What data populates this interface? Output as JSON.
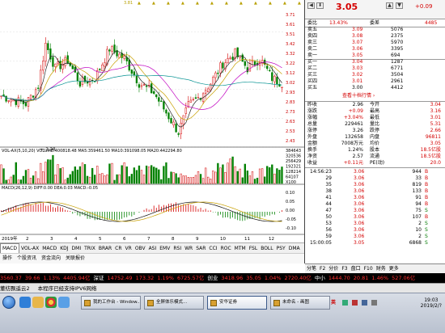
{
  "top_markers": [
    "3.81",
    "▲",
    "▲",
    "▲",
    "▲",
    "▲",
    "▲",
    "▲",
    "▲",
    "▲",
    "▲",
    "▲",
    "▲"
  ],
  "kline": {
    "title": "",
    "y_labels": [
      "3.81",
      "3.71",
      "3.61",
      "3.51",
      "3.42",
      "3.32",
      "3.22",
      "3.12",
      "3.02",
      "2.93",
      "2.83",
      "2.73",
      "2.63",
      "2.53",
      "2.43"
    ],
    "high_label": "3.81",
    "low_label": "2.38"
  },
  "volume": {
    "legend": "VOL-AX(5,10,20) VOLUME:400818.48 MA5:359461.50 MA10:391098.05 MA20:442294.80",
    "y_labels": [
      "384643",
      "320536",
      "256429",
      "192321",
      "128214",
      "64107",
      "X100"
    ]
  },
  "macd": {
    "legend": "MACD(26,12,9) DIFF:0.00 DEA:0.03 MACD:-0.05",
    "y_labels": [
      "0.10",
      "0.05",
      "0.00",
      "-0.05",
      "-0.10"
    ]
  },
  "x_axis": {
    "labels": [
      "2019年",
      "2",
      "3",
      "4",
      "5",
      "6",
      "7",
      "8",
      "9",
      "10",
      "11",
      "12"
    ]
  },
  "indicator_tabs": [
    "MACD",
    "VOL-AX",
    "MACD",
    "KDJ",
    "DMI",
    "TRIX",
    "BRAR",
    "CR",
    "VR",
    "OBV",
    "ASI",
    "EMV",
    "RSI",
    "WR",
    "SAR",
    "CCI",
    "ROC",
    "MTM",
    "FSL",
    "BOLL",
    "PSY",
    "DMA"
  ],
  "sub_tabs": [
    "操作",
    "个股资讯",
    "资金流向",
    "关联报价"
  ],
  "quote": {
    "price": "3.05",
    "change": "+0.09",
    "header_icons": [
      "◀",
      "⬇",
      "▲",
      "▼"
    ],
    "wb": {
      "label": "委比",
      "val": "13.43%",
      "label2": "委差",
      "val2": "4485"
    },
    "sells": [
      {
        "label": "卖五",
        "price": "3.09",
        "vol": "5076"
      },
      {
        "label": "卖四",
        "price": "3.08",
        "vol": "2375"
      },
      {
        "label": "卖三",
        "price": "3.07",
        "vol": "5970"
      },
      {
        "label": "卖二",
        "price": "3.06",
        "vol": "3395"
      },
      {
        "label": "卖一",
        "price": "3.05",
        "vol": "694"
      }
    ],
    "buys": [
      {
        "label": "买一",
        "price": "3.04",
        "vol": "1287"
      },
      {
        "label": "买二",
        "price": "3.03",
        "vol": "6771"
      },
      {
        "label": "买三",
        "price": "3.02",
        "vol": "3504"
      },
      {
        "label": "买四",
        "price": "3.01",
        "vol": "2961"
      },
      {
        "label": "买五",
        "price": "3.00",
        "vol": "4412"
      }
    ],
    "link": "查看十档行情 ›",
    "stats": [
      {
        "l1": "昨收",
        "v1": "2.96",
        "l2": "今开",
        "v2": "3.04"
      },
      {
        "l1": "涨跌",
        "v1": "+0.09",
        "l2": "最高",
        "v2": "3.16"
      },
      {
        "l1": "涨幅",
        "v1": "+3.04%",
        "l2": "最低",
        "v2": "3.01"
      },
      {
        "l1": "总量",
        "v1": "229461",
        "l2": "量比",
        "v2": "5.31"
      },
      {
        "l1": "涨停",
        "v1": "3.26",
        "l2": "跌停",
        "v2": "2.66"
      },
      {
        "l1": "外盘",
        "v1": "132658",
        "l2": "内盘",
        "v2": "96811"
      },
      {
        "l1": "金额",
        "v1": "7008万元",
        "l2": "均价",
        "v2": "3.05"
      },
      {
        "l1": "换手",
        "v1": "1.24%",
        "l2": "股本",
        "v2": "18.5亿股"
      },
      {
        "l1": "净资",
        "v1": "2.57",
        "l2": "流通",
        "v2": "18.5亿股"
      },
      {
        "l1": "收益",
        "v1": "+0.11元",
        "l2": "PE(动)",
        "v2": "20.0"
      }
    ],
    "trades": [
      {
        "t": "14:56:23",
        "p": "3.06",
        "v": "944",
        "d": "B"
      },
      {
        "t": "29",
        "p": "3.06",
        "v": "33",
        "d": "B"
      },
      {
        "t": "35",
        "p": "3.06",
        "v": "819",
        "d": "B"
      },
      {
        "t": "38",
        "p": "3.06",
        "v": "133",
        "d": "B"
      },
      {
        "t": "41",
        "p": "3.06",
        "v": "91",
        "d": "B"
      },
      {
        "t": "44",
        "p": "3.06",
        "v": "94",
        "d": "B"
      },
      {
        "t": "47",
        "p": "3.06",
        "v": "75",
        "d": "S"
      },
      {
        "t": "50",
        "p": "3.06",
        "v": "107",
        "d": "B"
      },
      {
        "t": "53",
        "p": "3.06",
        "v": "2",
        "d": "S"
      },
      {
        "t": "56",
        "p": "3.06",
        "v": "10",
        "d": "S"
      },
      {
        "t": "59",
        "p": "3.06",
        "v": "2",
        "d": "S"
      },
      {
        "t": "15:00:05",
        "p": "3.05",
        "v": "6868",
        "d": "S"
      }
    ],
    "tabs": [
      "分笔",
      "F2",
      "分价",
      "F3",
      "盘口",
      "F10",
      "财务",
      "更多"
    ]
  },
  "ticker": [
    {
      "t": "3560.37",
      "c": "red"
    },
    {
      "t": "39.66",
      "c": "red"
    },
    {
      "t": "1.13%",
      "c": "red"
    },
    {
      "t": "4405.94亿",
      "c": "red"
    },
    {
      "t": "深证",
      "c": "white"
    },
    {
      "t": "14752.49",
      "c": "red"
    },
    {
      "t": "173.32",
      "c": "red"
    },
    {
      "t": "1.19%",
      "c": "red"
    },
    {
      "t": "6725.57亿",
      "c": "red"
    },
    {
      "t": "创业",
      "c": "white"
    },
    {
      "t": "3418.96",
      "c": "red"
    },
    {
      "t": "35.05",
      "c": "red"
    },
    {
      "t": "1.04%",
      "c": "red"
    },
    {
      "t": "2720.40亿",
      "c": "red"
    },
    {
      "t": "中小",
      "c": "white"
    },
    {
      "t": "1444.70",
      "c": "red"
    },
    {
      "t": "20.81",
      "c": "red"
    },
    {
      "t": "1.46%",
      "c": "red"
    },
    {
      "t": "527.06亿",
      "c": "red"
    }
  ],
  "notice": [
    "董纺飘遥云2",
    "本程序已经支持IPV6网络"
  ],
  "taskbar": {
    "windows": [
      "我的工作台 - Window...",
      "全屏体乐模式...",
      "安华证券",
      "未命名 - 画图"
    ],
    "tray_text": "英",
    "clock_time": "19:03",
    "clock_date": "2019/2/?"
  }
}
